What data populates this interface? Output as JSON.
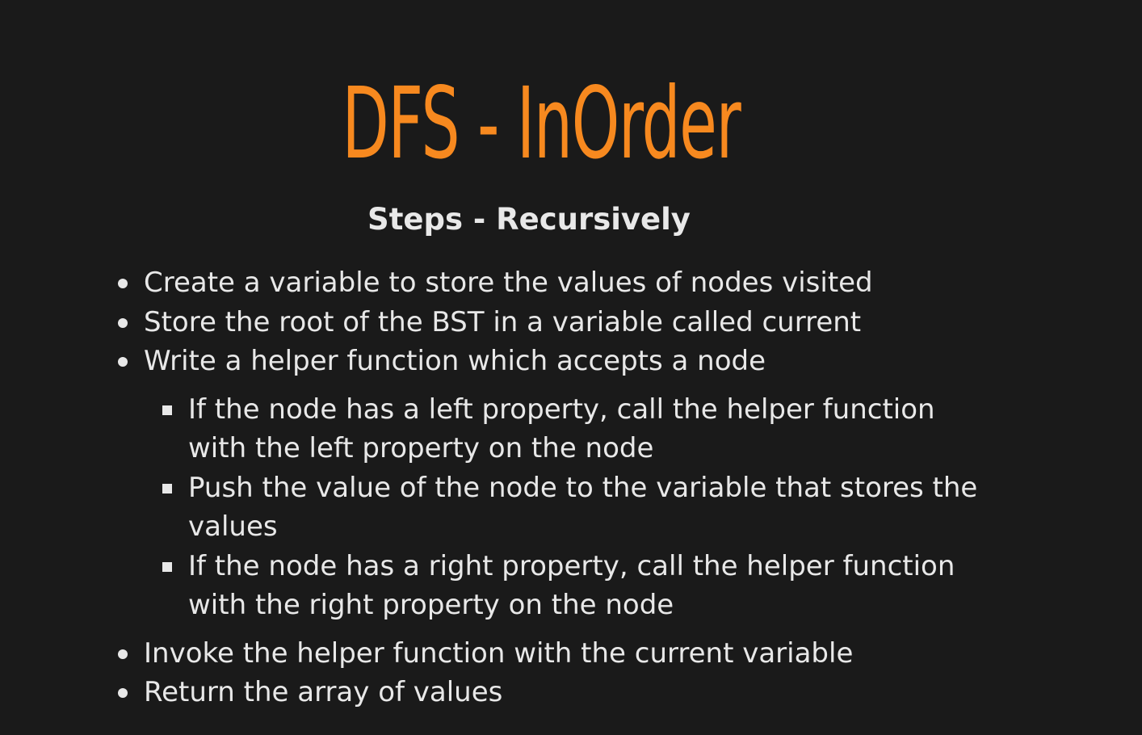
{
  "slide": {
    "title": "DFS - InOrder",
    "subtitle": "Steps - Recursively",
    "steps": [
      "Create a variable to store the values of nodes visited",
      "Store the root of the BST in a variable called current",
      "Write a helper function which accepts a node"
    ],
    "helper_steps": [
      "If the node has a left property, call the helper function with the left property on the node",
      "Push the value of the node to the variable that stores the values",
      "If the node has a right property, call the helper function with the right property on the node"
    ],
    "final_steps": [
      "Invoke the helper function with the current variable",
      "Return the array of values"
    ],
    "colors": {
      "background": "#1a1a1a",
      "title": "#f7891f",
      "text": "#e8e8e8"
    }
  }
}
